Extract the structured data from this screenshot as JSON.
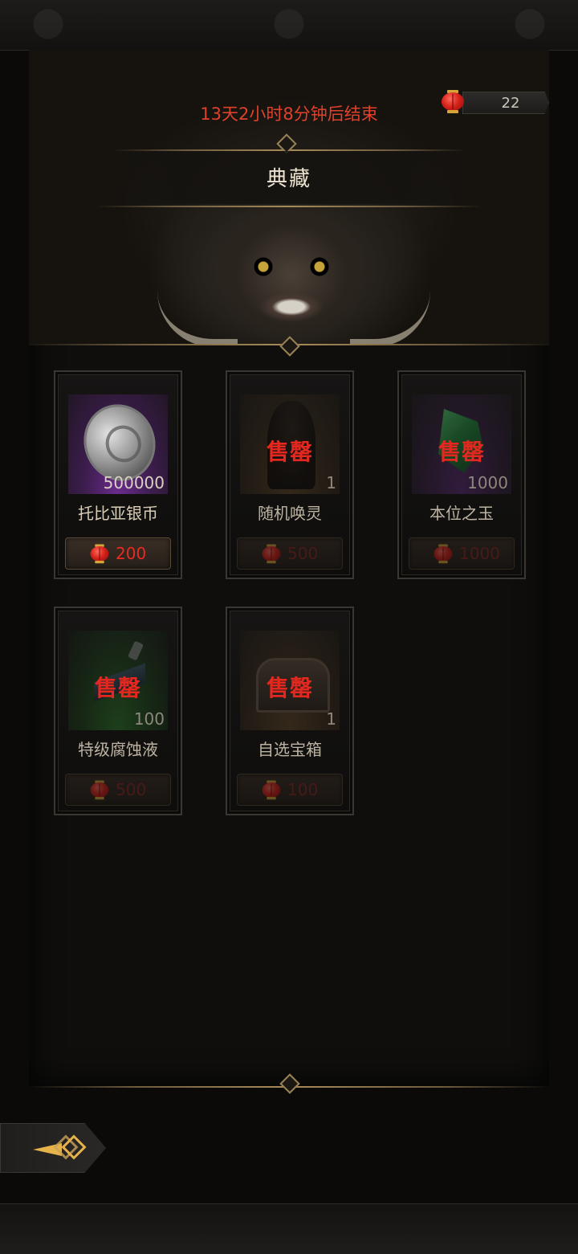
{
  "header": {
    "countdown": "13天2小时8分钟后结束",
    "title": "典藏",
    "currency": {
      "icon": "red-lantern-icon",
      "count": "22"
    }
  },
  "items": [
    {
      "name": "托比亚银币",
      "quantity": "500000",
      "price": "200",
      "sold_out": false,
      "sold_out_label": "",
      "icon": "silver-coin-icon",
      "rarity_color": "#6b2b8c"
    },
    {
      "name": "随机唤灵",
      "quantity": "1",
      "price": "500",
      "sold_out": true,
      "sold_out_label": "售罄",
      "icon": "spirit-portrait-icon",
      "rarity_color": "#5f4526"
    },
    {
      "name": "本位之玉",
      "quantity": "1000",
      "price": "1000",
      "sold_out": true,
      "sold_out_label": "售罄",
      "icon": "jade-gem-icon",
      "rarity_color": "#5c2a78"
    },
    {
      "name": "特级腐蚀液",
      "quantity": "100",
      "price": "500",
      "sold_out": true,
      "sold_out_label": "售罄",
      "icon": "corrosion-flask-icon",
      "rarity_color": "#2d7a2a"
    },
    {
      "name": "自选宝箱",
      "quantity": "1",
      "price": "100",
      "sold_out": true,
      "sold_out_label": "售罄",
      "icon": "treasure-chest-icon",
      "rarity_color": "#5f4526"
    }
  ],
  "colors": {
    "price_red": "#e62b22",
    "timer_red": "#e0412b",
    "gold_accent": "#e6b24b"
  },
  "footer": {
    "back_icon": "back-arrow-icon"
  }
}
